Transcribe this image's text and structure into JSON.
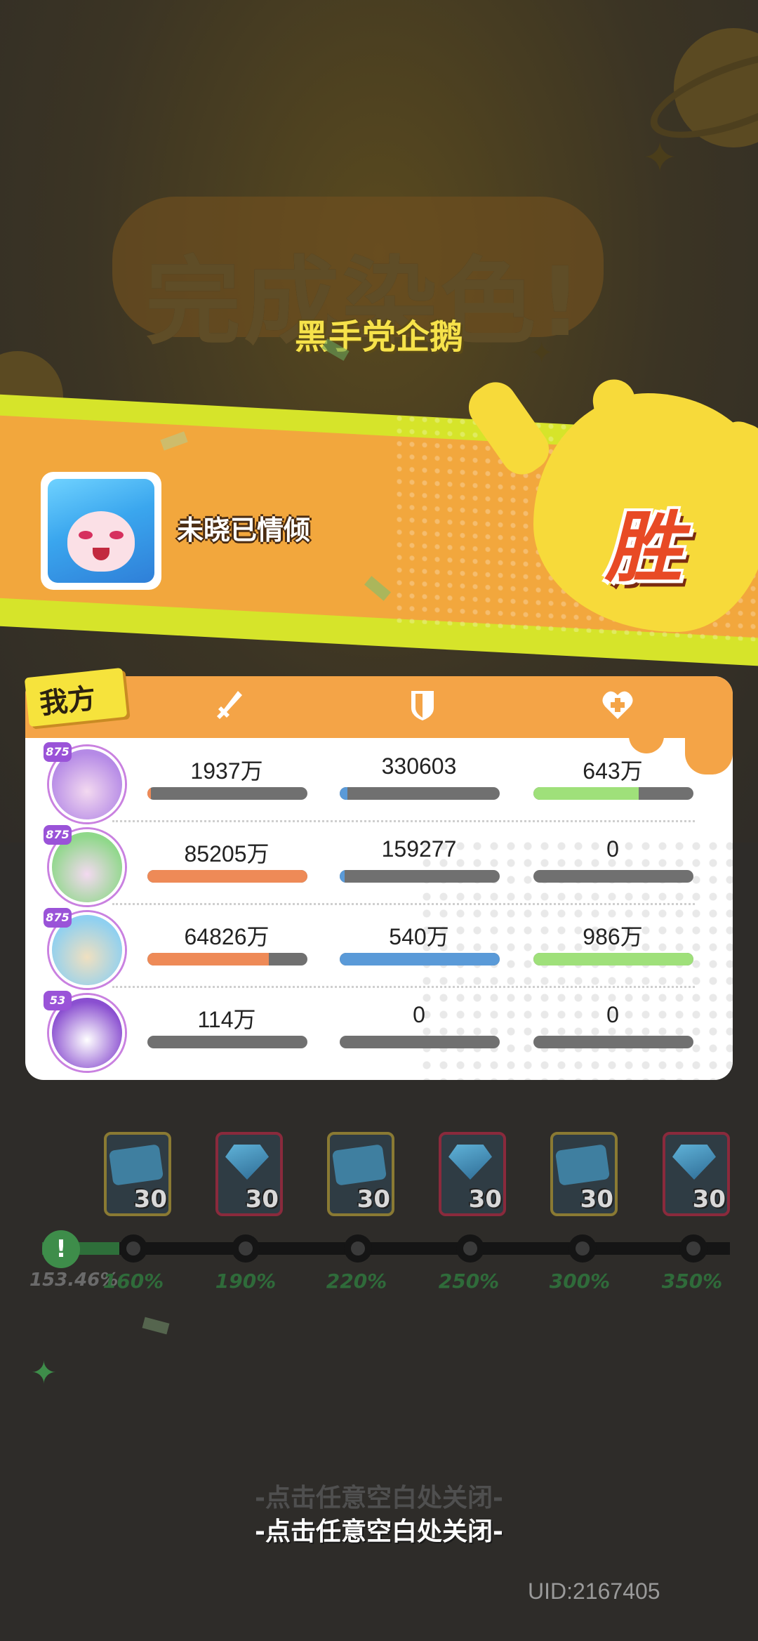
{
  "result": {
    "headline": "完成染色!",
    "subtitle": "黑手党企鹅",
    "player_name": "未晓已情倾",
    "outcome": "胜"
  },
  "panel": {
    "team_label": "我方",
    "column_icons": [
      "sword-icon",
      "shield-icon",
      "heart-plus-icon"
    ],
    "rows": [
      {
        "level": "875",
        "attack": "1937万",
        "defense": "330603",
        "heal": "643万",
        "attack_fill": 0.02,
        "defense_fill": 0.05,
        "heal_fill": 0.66
      },
      {
        "level": "875",
        "attack": "85205万",
        "defense": "159277",
        "heal": "0",
        "attack_fill": 1.0,
        "defense_fill": 0.03,
        "heal_fill": 0
      },
      {
        "level": "875",
        "attack": "64826万",
        "defense": "540万",
        "heal": "986万",
        "attack_fill": 0.76,
        "defense_fill": 1.0,
        "heal_fill": 1.0
      },
      {
        "level": "53",
        "attack": "114万",
        "defense": "0",
        "heal": "0",
        "attack_fill": 0,
        "defense_fill": 0,
        "heal_fill": 0
      }
    ]
  },
  "rewards": {
    "items": [
      {
        "type": "ticket",
        "qty": "30"
      },
      {
        "type": "gem",
        "qty": "30"
      },
      {
        "type": "ticket",
        "qty": "30"
      },
      {
        "type": "gem",
        "qty": "30"
      },
      {
        "type": "ticket",
        "qty": "30"
      },
      {
        "type": "gem",
        "qty": "30"
      }
    ],
    "current_percent": "153.46%",
    "thresholds": [
      "160%",
      "190%",
      "220%",
      "250%",
      "300%",
      "350%"
    ]
  },
  "footer": {
    "close_hint": "-点击任意空白处关闭-",
    "uid": "UID:2167405"
  },
  "colors": {
    "attack": "#ee8a57",
    "defense": "#5a9ad8",
    "heal": "#9fe07a",
    "bar_empty": "#707070",
    "header": "#f4a447"
  }
}
